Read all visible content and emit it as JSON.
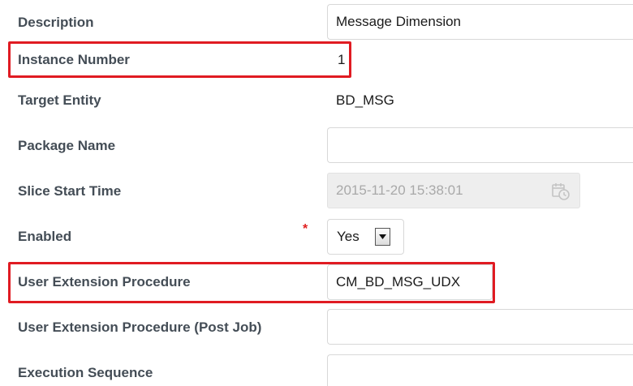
{
  "fields": {
    "description": {
      "label": "Description",
      "value": "Message Dimension"
    },
    "instance_number": {
      "label": "Instance Number",
      "value": "1"
    },
    "target_entity": {
      "label": "Target Entity",
      "value": "BD_MSG"
    },
    "package_name": {
      "label": "Package Name",
      "value": ""
    },
    "slice_start_time": {
      "label": "Slice Start Time",
      "value": "2015-11-20 15:38:01"
    },
    "enabled": {
      "label": "Enabled",
      "required_marker": "*",
      "value": "Yes"
    },
    "user_extension_procedure": {
      "label": "User Extension Procedure",
      "value": "CM_BD_MSG_UDX"
    },
    "user_extension_procedure_post_job": {
      "label": "User Extension Procedure (Post Job)",
      "value": ""
    },
    "execution_sequence": {
      "label": "Execution Sequence",
      "value": ""
    }
  },
  "icons": {
    "calendar": "calendar-clock-icon",
    "dropdown": "chevron-down-icon"
  },
  "colors": {
    "label": "#444d56",
    "highlight": "#e01b22",
    "required": "#e02020",
    "disabled_bg": "#eeeeee"
  }
}
